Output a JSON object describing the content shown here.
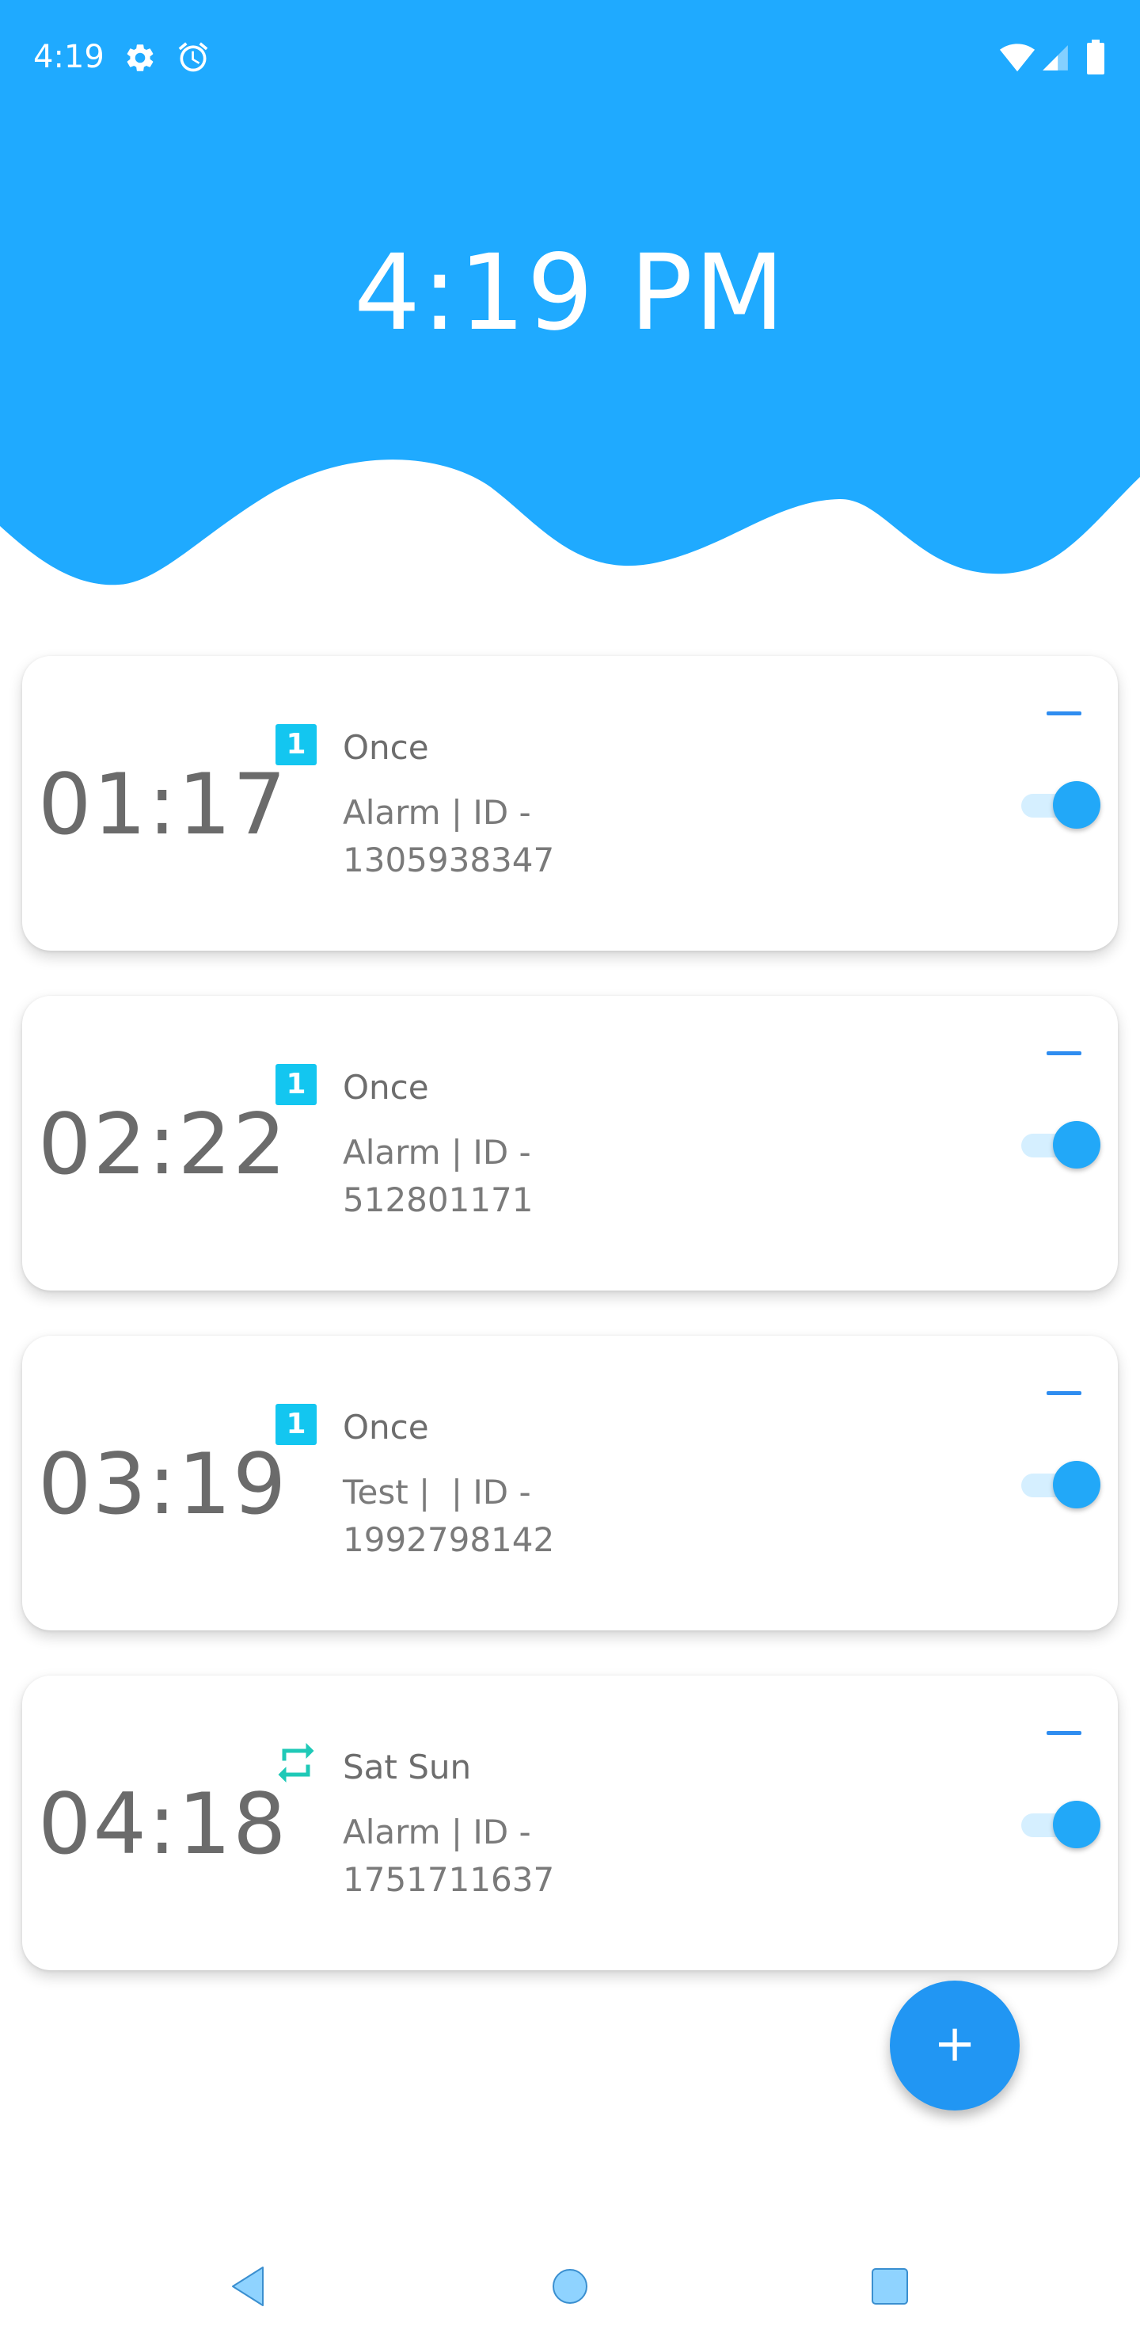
{
  "colors": {
    "header_blue": "#1faaff",
    "accent_blue": "#2196f3",
    "toggle_on": "#22a8f8",
    "once_badge": "#13c6f0",
    "repeat_icon": "#1fc9b7",
    "text_gray": "#6b6b6b"
  },
  "status_bar": {
    "time": "4:19",
    "icons": [
      "settings-icon",
      "alarm-clock-icon",
      "wifi-icon",
      "signal-icon",
      "battery-icon"
    ]
  },
  "header": {
    "current_time": "4:19 PM"
  },
  "alarms": [
    {
      "time": "01:17",
      "frequency_icon": "once-badge-icon",
      "frequency_badge": "1",
      "frequency_label": "Once",
      "description_line1": "Alarm | ID -",
      "description_line2": "1305938347",
      "enabled": true
    },
    {
      "time": "02:22",
      "frequency_icon": "once-badge-icon",
      "frequency_badge": "1",
      "frequency_label": "Once",
      "description_line1": "Alarm | ID -",
      "description_line2": "512801171",
      "enabled": true
    },
    {
      "time": "03:19",
      "frequency_icon": "once-badge-icon",
      "frequency_badge": "1",
      "frequency_label": "Once",
      "description_line1": "Test |  | ID -",
      "description_line2": "1992798142",
      "enabled": true
    },
    {
      "time": "04:18",
      "frequency_icon": "repeat-icon",
      "frequency_badge": "",
      "frequency_label": "Sat Sun",
      "description_line1": "Alarm | ID -",
      "description_line2": "1751711637",
      "enabled": true
    }
  ],
  "fab": {
    "label": "+",
    "icon": "plus-icon"
  },
  "nav_bar": {
    "buttons": [
      "back-icon",
      "home-icon",
      "recents-icon"
    ]
  }
}
